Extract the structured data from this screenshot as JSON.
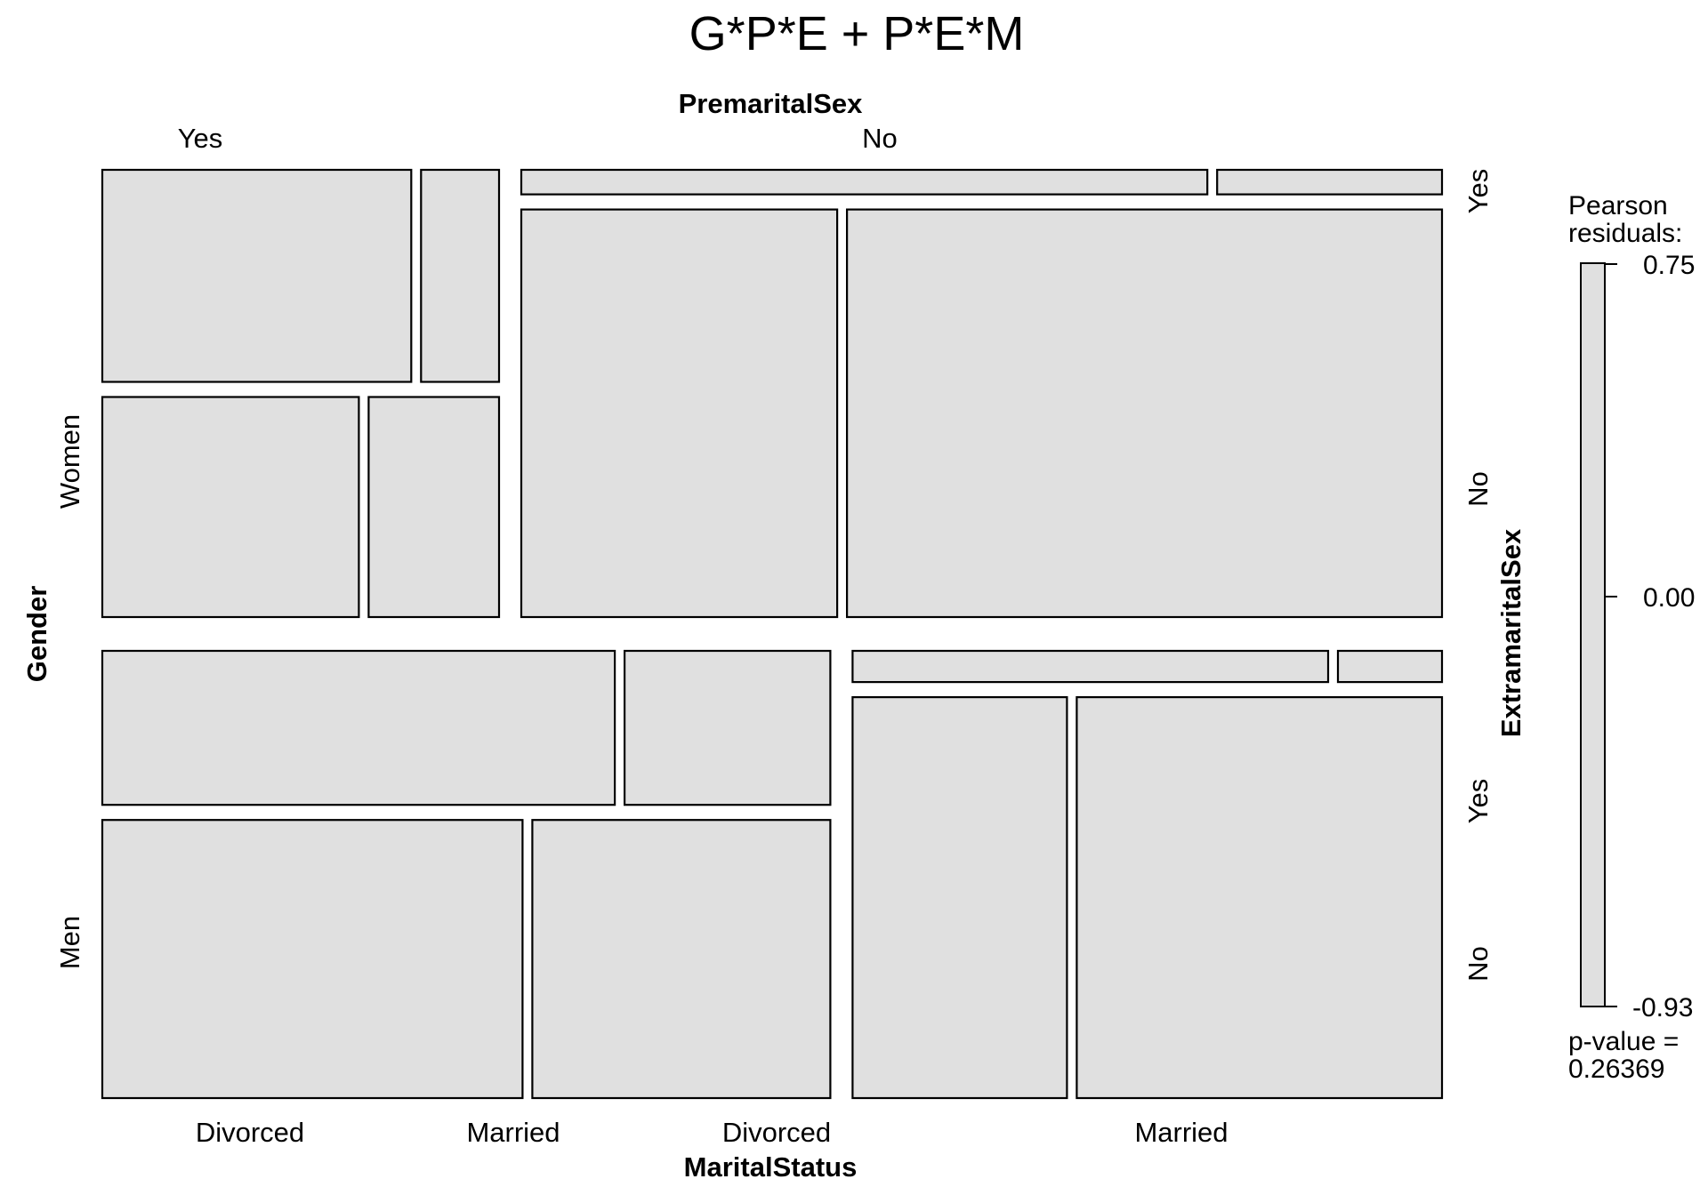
{
  "chart_data": {
    "type": "mosaic",
    "title": "G*P*E + P*E*M",
    "variables": {
      "top": "PremaritalSex",
      "bottom": "MaritalStatus",
      "left": "Gender",
      "right": "ExtramaritalSex"
    },
    "levels": {
      "PremaritalSex": [
        "Yes",
        "No"
      ],
      "Gender": [
        "Women",
        "Men"
      ],
      "ExtramaritalSex": [
        "Yes",
        "No"
      ],
      "MaritalStatus": [
        "Divorced",
        "Married"
      ]
    },
    "bottom_labels": [
      "Divorced",
      "Married",
      "Divorced",
      "Married"
    ],
    "cell_color": "#e0e0e0",
    "cells": [
      {
        "gender": "Women",
        "premarital": "Yes",
        "extramarital": "Yes",
        "marital": "Divorced",
        "proportion": 0.118
      },
      {
        "gender": "Women",
        "premarital": "Yes",
        "extramarital": "Yes",
        "marital": "Married",
        "proportion": 0.0298
      },
      {
        "gender": "Women",
        "premarital": "Yes",
        "extramarital": "No",
        "marital": "Divorced",
        "proportion": 0.1017
      },
      {
        "gender": "Women",
        "premarital": "Yes",
        "extramarital": "No",
        "marital": "Married",
        "proportion": 0.0517
      },
      {
        "gender": "Women",
        "premarital": "No",
        "extramarital": "Yes",
        "marital": "Divorced",
        "proportion": 0.0299
      },
      {
        "gender": "Women",
        "premarital": "No",
        "extramarital": "Yes",
        "marital": "Married",
        "proportion": 0.0098
      },
      {
        "gender": "Women",
        "premarital": "No",
        "extramarital": "No",
        "marital": "Divorced",
        "proportion": 0.2286
      },
      {
        "gender": "Women",
        "premarital": "No",
        "extramarital": "No",
        "marital": "Married",
        "proportion": 0.4306
      },
      {
        "gender": "Men",
        "premarital": "Yes",
        "extramarital": "Yes",
        "marital": "Divorced",
        "proportion": 0.1405
      },
      {
        "gender": "Men",
        "premarital": "Yes",
        "extramarital": "Yes",
        "marital": "Married",
        "proportion": 0.0564
      },
      {
        "gender": "Men",
        "premarital": "Yes",
        "extramarital": "No",
        "marital": "Divorced",
        "proportion": 0.2081
      },
      {
        "gender": "Men",
        "premarital": "Yes",
        "extramarital": "No",
        "marital": "Married",
        "proportion": 0.1476
      },
      {
        "gender": "Men",
        "premarital": "No",
        "extramarital": "Yes",
        "marital": "Divorced",
        "proportion": 0.0265
      },
      {
        "gender": "Men",
        "premarital": "No",
        "extramarital": "Yes",
        "marital": "Married",
        "proportion": 0.0058
      },
      {
        "gender": "Men",
        "premarital": "No",
        "extramarital": "No",
        "marital": "Divorced",
        "proportion": 0.1535
      },
      {
        "gender": "Men",
        "premarital": "No",
        "extramarital": "No",
        "marital": "Married",
        "proportion": 0.2616
      }
    ],
    "legend": {
      "title_line1": "Pearson",
      "title_line2": "residuals:",
      "max_label": "0.75",
      "mid_label": "0.00",
      "min_label": "-0.93",
      "range": [
        -0.93,
        0.75
      ],
      "pvalue_line1": "p-value =",
      "pvalue_line2": "0.26369",
      "placement": "right"
    }
  }
}
